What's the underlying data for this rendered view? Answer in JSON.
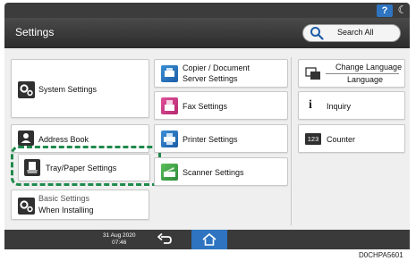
{
  "topbar": {
    "help_label": "?",
    "moon_icon": "moon-icon"
  },
  "header": {
    "title": "Settings",
    "search_label": "Search All"
  },
  "tiles": {
    "system_settings": "System Settings",
    "copier_doc_server": [
      "Copier / Document",
      "Server Settings"
    ],
    "fax_settings": "Fax Settings",
    "printer_settings": "Printer Settings",
    "scanner_settings": "Scanner Settings",
    "address_book": "Address Book",
    "tray_paper_settings": "Tray/Paper Settings",
    "basic_settings": [
      "Basic Settings",
      "When Installing"
    ],
    "change_language": "Change Language",
    "language": "Language",
    "inquiry": "Inquiry",
    "counter": "Counter",
    "counter_icon_text": "123",
    "inquiry_icon_text": "i"
  },
  "bottombar": {
    "date": "31 Aug 2020",
    "time": "07:46"
  },
  "doc_id": "D0CHPA5601",
  "colors": {
    "accent_blue": "#2e74c0",
    "highlight_green": "#1f8a4c",
    "header_dark": "#3c3c3c"
  }
}
